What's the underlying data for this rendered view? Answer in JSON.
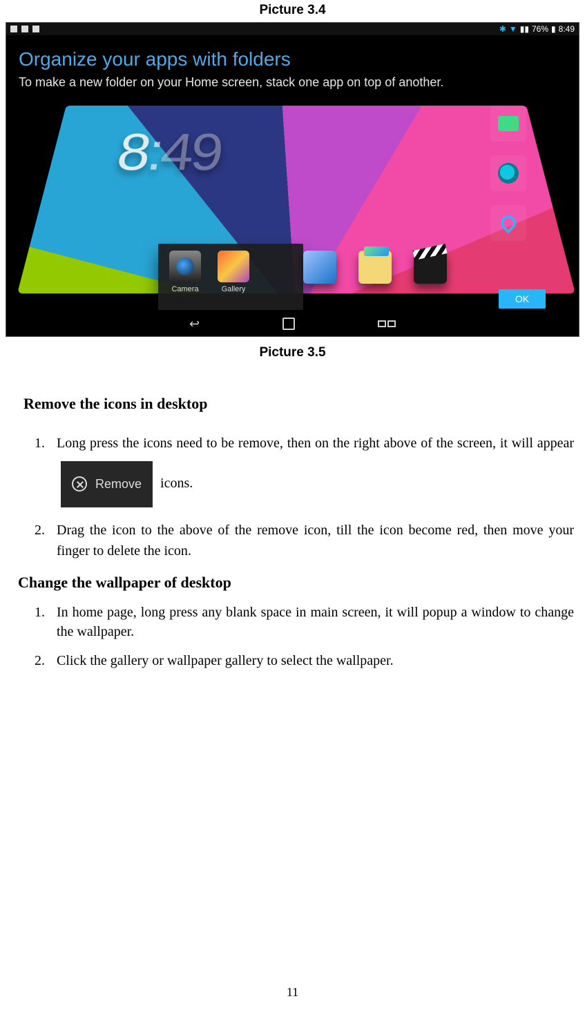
{
  "captions": {
    "top": "Picture 3.4",
    "mid": "Picture 3.5"
  },
  "statusbar": {
    "battery": "76%",
    "time": "8:49"
  },
  "banner": {
    "title": "Organize your apps with folders",
    "subtitle": "To make a new folder on your Home screen, stack one app on top of another."
  },
  "clock": {
    "h": "8",
    "m": "49"
  },
  "folder": {
    "app1": "Camera",
    "app2": "Gallery"
  },
  "ok_button": "OK",
  "sections": {
    "removeHead": "Remove the icons in desktop",
    "remove1a": "Long press the icons need to be remove, then on the right above of the screen, it will appear",
    "removeBadge": "Remove",
    "remove1b": "icons.",
    "remove2": "Drag the icon to the above of the remove icon, till the icon become red, then move your finger to delete the icon.",
    "wallpaperHead": "Change the wallpaper of desktop",
    "wall1": "In home page, long press any blank space in main screen, it will popup a window to change the wallpaper.",
    "wall2": "Click the gallery or wallpaper gallery to select the wallpaper."
  },
  "pagenum": "11"
}
